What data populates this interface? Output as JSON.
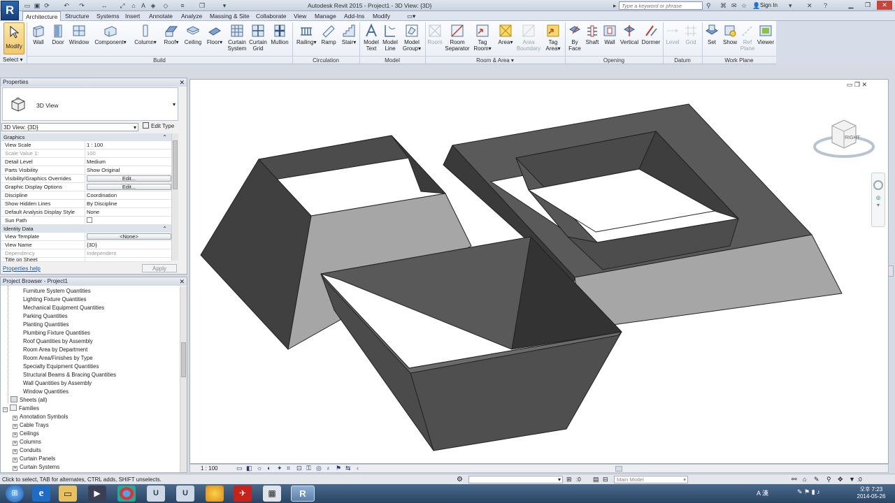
{
  "app": {
    "title": "Autodesk Revit 2015 -    Project1 - 3D View: {3D}",
    "logo": "R"
  },
  "search": {
    "placeholder": "Type a keyword or phrase"
  },
  "sign_in": "Sign In",
  "tabs": [
    "Architecture",
    "Structure",
    "Systems",
    "Insert",
    "Annotate",
    "Analyze",
    "Massing & Site",
    "Collaborate",
    "View",
    "Manage",
    "Add-Ins",
    "Modify"
  ],
  "active_tab": "Architecture",
  "ribbon": {
    "modify": "Modify",
    "select": "Select",
    "build": {
      "label": "Build",
      "buttons": [
        "Wall",
        "Door",
        "Window",
        "Component",
        "Column",
        "Roof",
        "Ceiling",
        "Floor",
        "Curtain System",
        "Curtain Grid",
        "Mullion"
      ]
    },
    "circulation": {
      "label": "Circulation",
      "buttons": [
        "Railing",
        "Ramp",
        "Stair"
      ]
    },
    "model": {
      "label": "Model",
      "buttons": [
        "Model Text",
        "Model Line",
        "Model Group"
      ]
    },
    "room_area": {
      "label": "Room & Area",
      "buttons": [
        "Room",
        "Room Separator",
        "Tag Room",
        "Area",
        "Area Boundary",
        "Tag Area"
      ]
    },
    "opening": {
      "label": "Opening",
      "buttons": [
        "By Face",
        "Shaft",
        "Wall",
        "Vertical",
        "Dormer"
      ]
    },
    "datum": {
      "label": "Datum",
      "buttons": [
        "Level",
        "Grid"
      ]
    },
    "work_plane": {
      "label": "Work Plane",
      "buttons": [
        "Set",
        "Show",
        "Ref Plane",
        "Viewer"
      ]
    }
  },
  "properties": {
    "title": "Properties",
    "type_name": "3D View",
    "view_selector": "3D View: {3D}",
    "edit_type": "Edit Type",
    "groups": [
      {
        "name": "Graphics",
        "rows": [
          {
            "k": "View Scale",
            "v": "1 : 100"
          },
          {
            "k": "Scale Value    1:",
            "v": "100"
          },
          {
            "k": "Detail Level",
            "v": "Medium"
          },
          {
            "k": "Parts Visibility",
            "v": "Show Original"
          },
          {
            "k": "Visibility/Graphics Overrides",
            "v": "Edit..."
          },
          {
            "k": "Graphic Display Options",
            "v": "Edit..."
          },
          {
            "k": "Discipline",
            "v": "Coordination"
          },
          {
            "k": "Show Hidden Lines",
            "v": "By Discipline"
          },
          {
            "k": "Default Analysis Display Style",
            "v": "None"
          },
          {
            "k": "Sun Path",
            "v": ""
          }
        ]
      },
      {
        "name": "Identity Data",
        "rows": [
          {
            "k": "View Template",
            "v": "<None>"
          },
          {
            "k": "View Name",
            "v": "{3D}"
          },
          {
            "k": "Dependency",
            "v": "Independent"
          },
          {
            "k": "Title on Sheet",
            "v": ""
          }
        ]
      }
    ],
    "help": "Properties help",
    "apply": "Apply"
  },
  "browser": {
    "title": "Project Browser - Project1",
    "schedules": [
      "Furniture System Quantities",
      "Lighting Fixture Quantities",
      "Mechanical Equipment Quantities",
      "Parking Quantities",
      "Planting Quantities",
      "Plumbing Fixture Quantities",
      "Roof Quantities by Assembly",
      "Room Area by Department",
      "Room Area/Finishes by Type",
      "Specialty Equipment Quantities",
      "Structural Beams & Bracing Quantities",
      "Wall Quantities by Assembly",
      "Window Quantities"
    ],
    "sheets": "Sheets (all)",
    "families": "Families",
    "family_items": [
      "Annotation Symbols",
      "Cable Trays",
      "Ceilings",
      "Columns",
      "Conduits",
      "Curtain Panels",
      "Curtain Systems"
    ]
  },
  "view_cube": {
    "face": "RIGHT"
  },
  "view_bar": {
    "scale": "1 : 100"
  },
  "status": {
    "message": "Click to select, TAB for alternates, CTRL adds, SHIFT unselects.",
    "count": ":0",
    "model": "Main Model",
    "filter": ":0"
  },
  "taskbar": {
    "time": "오후 7:23",
    "date": "2014-05-26",
    "ime": "A 漢"
  },
  "colors": {
    "accent": "#2a66b0",
    "wall_dark": "#4a4a4a",
    "wall_mid": "#5a5a5a",
    "wall_light": "#a6a6a6"
  }
}
